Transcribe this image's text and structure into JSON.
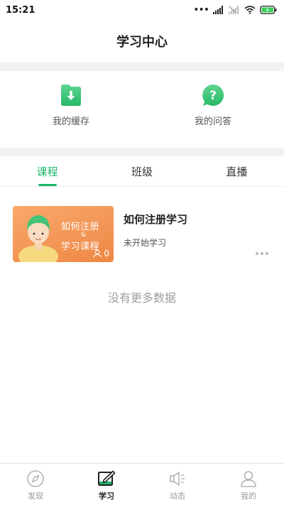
{
  "status_bar": {
    "time": "15:21"
  },
  "header": {
    "title": "学习中心"
  },
  "quick_links": [
    {
      "label": "我的缓存",
      "icon": "download-folder-icon"
    },
    {
      "label": "我的问答",
      "icon": "question-bubble-icon"
    }
  ],
  "tabs": [
    {
      "label": "课程",
      "active": true
    },
    {
      "label": "班级",
      "active": false
    },
    {
      "label": "直播",
      "active": false
    }
  ],
  "courses": [
    {
      "title": "如何注册学习",
      "status": "未开始学习",
      "thumbnail": {
        "line1": "如何注册",
        "amp": "&",
        "line2": "学习课程",
        "learner_count": "0"
      }
    }
  ],
  "list_footer": "没有更多数据",
  "tab_bar": [
    {
      "label": "发现",
      "icon": "compass-icon",
      "active": false
    },
    {
      "label": "学习",
      "icon": "study-pen-icon",
      "active": true
    },
    {
      "label": "动态",
      "icon": "speaker-icon",
      "active": false
    },
    {
      "label": "我的",
      "icon": "person-icon",
      "active": false
    }
  ],
  "colors": {
    "accent": "#1db56b",
    "thumbnail_orange": "#f29a57",
    "background_gap": "#f2f2f2"
  }
}
